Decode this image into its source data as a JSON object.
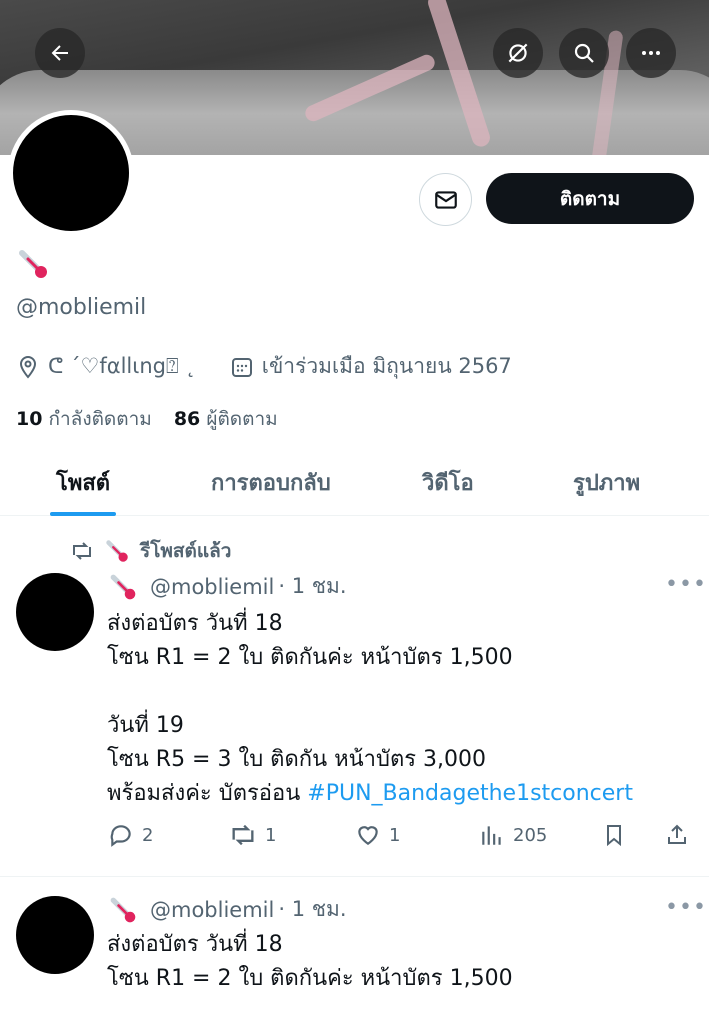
{
  "profile": {
    "display_name_icon": "thermometer-emoji",
    "handle": "@mobliemil",
    "location": "ᕦ ˊ♡fαllιng⍰ ˛",
    "joined": "เข้าร่วมเมือ มิถุนายน 2567",
    "following_count": "10",
    "following_label": "กำลังติดตาม",
    "followers_count": "86",
    "followers_label": "ผู้ติดตาม",
    "follow_label": "ติดตาม"
  },
  "tabs": [
    {
      "label": "โพสต์",
      "active": true
    },
    {
      "label": "การตอบกลับ",
      "active": false
    },
    {
      "label": "วิดีโอ",
      "active": false
    },
    {
      "label": "รูปภาพ",
      "active": false
    }
  ],
  "repost_label": "รีโพสต์แล้ว",
  "posts": [
    {
      "handle": "@mobliemil",
      "time": "· 1 ชม.",
      "text": "ส่งต่อบัตร วันที่ 18\nโซน R1 = 2 ใบ ติดกันค่ะ หน้าบัตร 1,500\n\nวันที่ 19\nโซน R5 = 3 ใบ ติดกัน หน้าบัตร 3,000\nพร้อมส่งค่ะ บัตรอ่อน ",
      "hashtag": "#PUN_Bandagethe1stconcert",
      "replies": "2",
      "reposts": "1",
      "likes": "1",
      "views": "205"
    },
    {
      "handle": "@mobliemil",
      "time": "· 1 ชม.",
      "text": "ส่งต่อบัตร วันที่ 18\nโซน R1 = 2 ใบ ติดกันค่ะ หน้าบัตร 1,500"
    }
  ],
  "colors": {
    "accent": "#1d9bf0",
    "text": "#0f1419",
    "muted": "#536471"
  }
}
